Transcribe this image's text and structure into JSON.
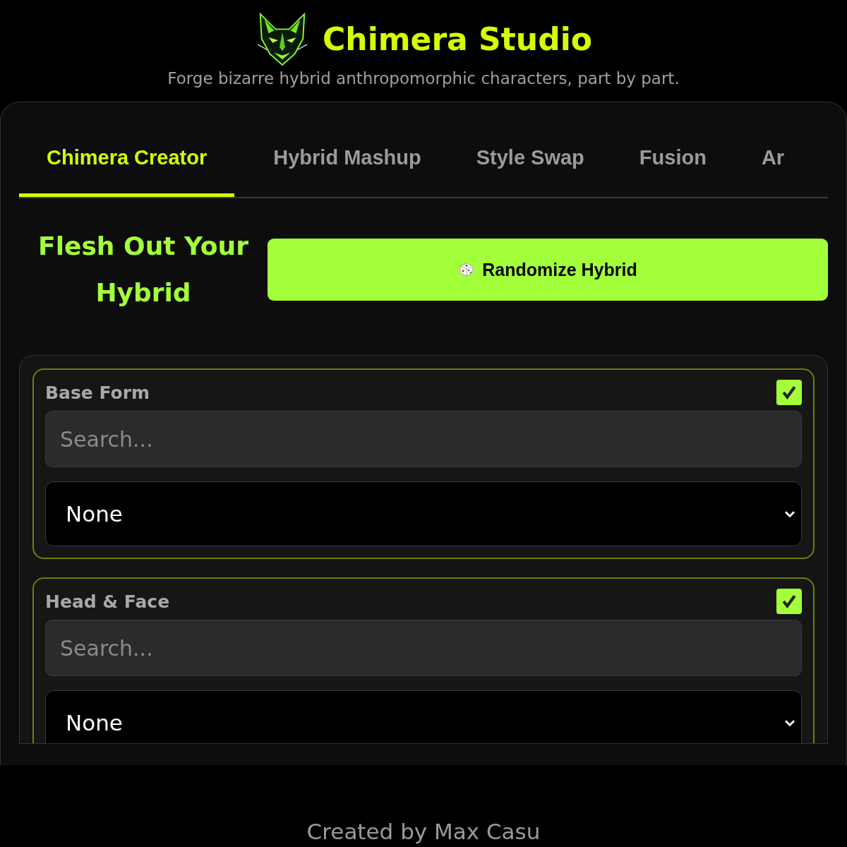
{
  "header": {
    "title": "Chimera Studio",
    "subtitle": "Forge bizarre hybrid anthropomorphic characters, part by part."
  },
  "tabs": [
    {
      "label": "Chimera Creator",
      "selected": true
    },
    {
      "label": "Hybrid Mashup",
      "selected": false
    },
    {
      "label": "Style Swap",
      "selected": false
    },
    {
      "label": "Fusion",
      "selected": false
    },
    {
      "label": "Ar",
      "selected": false
    }
  ],
  "heading": "Flesh Out Your Hybrid",
  "randomize_button": "Randomize Hybrid",
  "sections": [
    {
      "label": "Base Form",
      "checked": true,
      "search_placeholder": "Search...",
      "value": "None"
    },
    {
      "label": "Head & Face",
      "checked": true,
      "search_placeholder": "Search...",
      "value": "None"
    }
  ],
  "footer": "Created by Max Casu"
}
